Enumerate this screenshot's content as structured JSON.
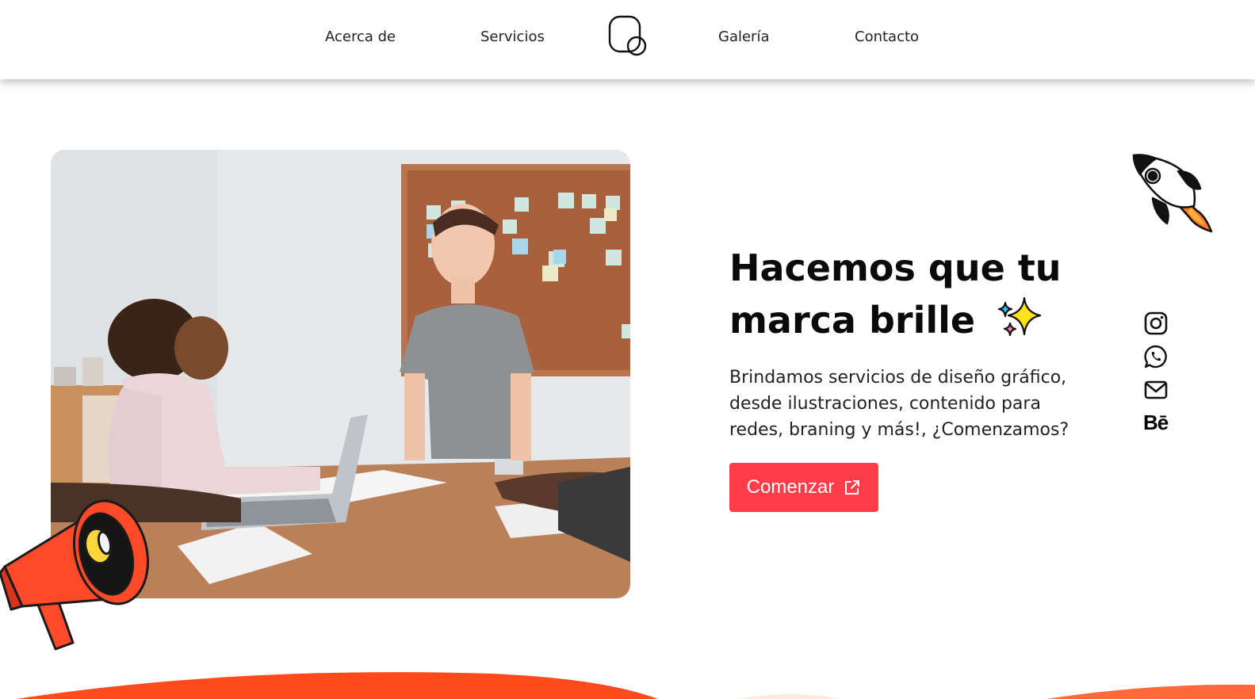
{
  "nav": {
    "items": [
      "Acerca de",
      "Servicios",
      "Galería",
      "Contacto"
    ]
  },
  "hero": {
    "headline_line1": "Hacemos que tu",
    "headline_line2": "marca brille",
    "description": "Brindamos servicios de diseño gráfico, desde ilustraciones, contenido para redes, braning y más!, ¿Comenzamos?",
    "cta_label": "Comenzar"
  },
  "social": {
    "behance_label": "Bē",
    "icons": [
      "instagram-icon",
      "whatsapp-icon",
      "mail-icon",
      "behance-icon"
    ]
  },
  "colors": {
    "accent": "#ff3d4a",
    "wave": "#ff4a1c",
    "megaphone": "#ff4a2a",
    "sparkle_yellow": "#ffe21a",
    "sparkle_cyan": "#29c4e8",
    "sparkle_pink": "#ff7eb3"
  }
}
